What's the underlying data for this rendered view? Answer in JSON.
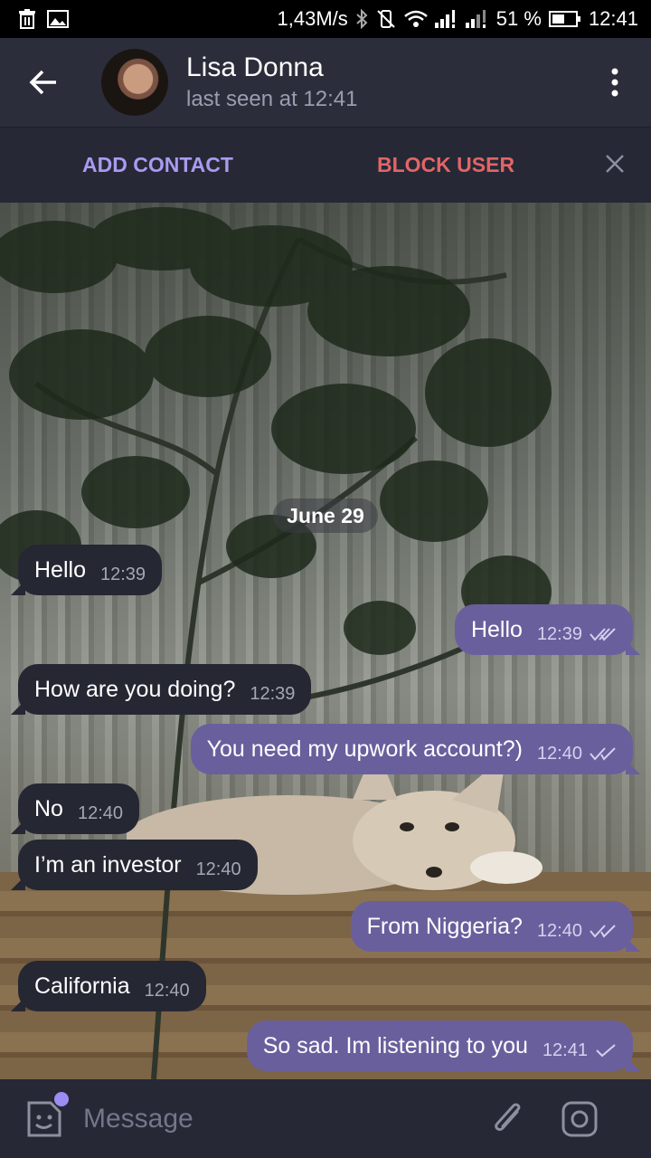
{
  "status_bar": {
    "speed": "1,43M/s",
    "battery": "51 %",
    "time": "12:41"
  },
  "header": {
    "name": "Lisa Donna",
    "last_seen": "last seen at 12:41"
  },
  "actions": {
    "add_contact": "ADD CONTACT",
    "block_user": "BLOCK USER"
  },
  "date_chip": "June 29",
  "messages": [
    {
      "direction": "in",
      "text": "Hello",
      "time": "12:39"
    },
    {
      "direction": "out",
      "text": "Hello",
      "time": "12:39",
      "status": "read"
    },
    {
      "direction": "in",
      "text": "How are you doing?",
      "time": "12:39"
    },
    {
      "direction": "out",
      "text": "You need my upwork account?)",
      "time": "12:40",
      "status": "read"
    },
    {
      "direction": "in",
      "text": "No",
      "time": "12:40"
    },
    {
      "direction": "in",
      "text": "I’m an investor",
      "time": "12:40"
    },
    {
      "direction": "out",
      "text": "From Niggeria?",
      "time": "12:40",
      "status": "read"
    },
    {
      "direction": "in",
      "text": "California",
      "time": "12:40"
    },
    {
      "direction": "out",
      "text": "So sad. Im listening to you",
      "time": "12:41",
      "status": "sent"
    }
  ],
  "composer": {
    "placeholder": "Message"
  },
  "colors": {
    "incoming_bubble": "#252733",
    "outgoing_bubble": "#6a5f9d",
    "header": "#2b2d3b",
    "accent": "#a89bf1",
    "danger": "#e36566"
  }
}
